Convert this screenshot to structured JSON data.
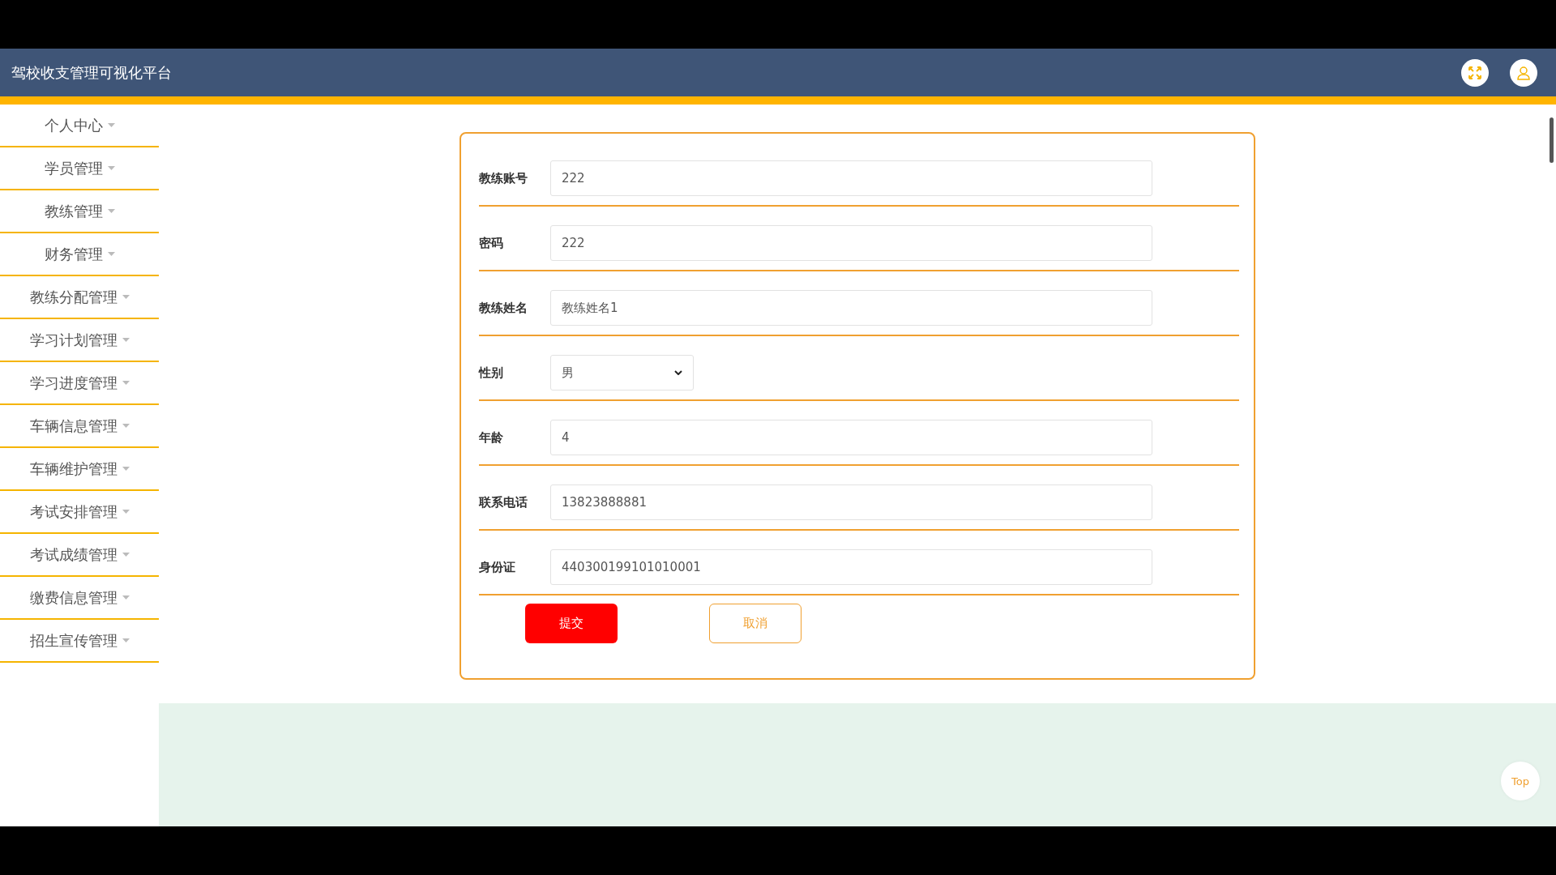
{
  "header": {
    "title": "驾校收支管理可视化平台"
  },
  "sidebar": {
    "items": [
      {
        "label": "个人中心"
      },
      {
        "label": "学员管理"
      },
      {
        "label": "教练管理"
      },
      {
        "label": "财务管理"
      },
      {
        "label": "教练分配管理"
      },
      {
        "label": "学习计划管理"
      },
      {
        "label": "学习进度管理"
      },
      {
        "label": "车辆信息管理"
      },
      {
        "label": "车辆维护管理"
      },
      {
        "label": "考试安排管理"
      },
      {
        "label": "考试成绩管理"
      },
      {
        "label": "缴费信息管理"
      },
      {
        "label": "招生宣传管理"
      }
    ]
  },
  "form": {
    "fields": [
      {
        "label": "教练账号",
        "kind": "text",
        "value": "222"
      },
      {
        "label": "密码",
        "kind": "text",
        "value": "222"
      },
      {
        "label": "教练姓名",
        "kind": "text",
        "value": "教练姓名1"
      },
      {
        "label": "性别",
        "kind": "select",
        "value": "男"
      },
      {
        "label": "年龄",
        "kind": "text",
        "value": "4"
      },
      {
        "label": "联系电话",
        "kind": "text",
        "value": "13823888881"
      },
      {
        "label": "身份证",
        "kind": "text",
        "value": "440300199101010001"
      }
    ],
    "buttons": [
      {
        "label": "提交",
        "kind": "primary"
      },
      {
        "label": "取消",
        "kind": "secondary"
      }
    ]
  },
  "top_button": {
    "label": "Top"
  }
}
